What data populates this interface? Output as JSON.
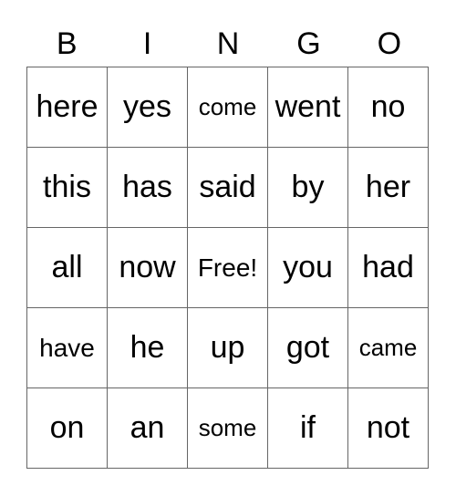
{
  "title_letters": [
    "B",
    "I",
    "N",
    "G",
    "O"
  ],
  "rows": [
    [
      "here",
      "yes",
      "come",
      "went",
      "no"
    ],
    [
      "this",
      "has",
      "said",
      "by",
      "her"
    ],
    [
      "all",
      "now",
      "Free!",
      "you",
      "had"
    ],
    [
      "have",
      "he",
      "up",
      "got",
      "came"
    ],
    [
      "on",
      "an",
      "some",
      "if",
      "not"
    ]
  ]
}
